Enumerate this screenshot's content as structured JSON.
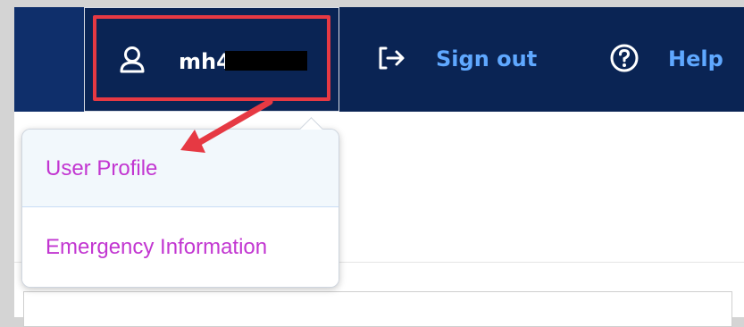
{
  "header": {
    "user": {
      "name": "mh4",
      "icon": "user-icon"
    },
    "signout": {
      "label": "Sign out",
      "icon": "signout-icon"
    },
    "help": {
      "label": "Help",
      "icon": "help-icon"
    }
  },
  "dropdown": {
    "items": [
      {
        "label": "User Profile"
      },
      {
        "label": "Emergency Information"
      }
    ]
  },
  "colors": {
    "navbar": "#0a2454",
    "link": "#5fa8ff",
    "menu_text": "#c236d1",
    "annotation": "#e63943"
  }
}
